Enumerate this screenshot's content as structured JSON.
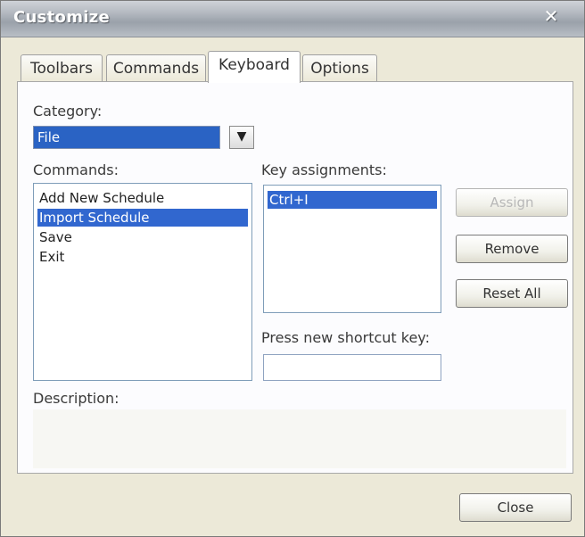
{
  "window": {
    "title": "Customize"
  },
  "tabs": [
    {
      "label": "Toolbars",
      "active": false
    },
    {
      "label": "Commands",
      "active": false
    },
    {
      "label": "Keyboard",
      "active": true
    },
    {
      "label": "Options",
      "active": false
    }
  ],
  "category": {
    "label": "Category:",
    "selected": "File"
  },
  "commands": {
    "label": "Commands:",
    "items": [
      "Add New Schedule",
      "Import Schedule",
      "Save",
      "Exit"
    ],
    "selected_index": 1
  },
  "key_assignments": {
    "label": "Key assignments:",
    "items": [
      "Ctrl+I"
    ],
    "selected_index": 0
  },
  "buttons": {
    "assign": "Assign",
    "remove": "Remove",
    "reset_all": "Reset All",
    "close": "Close"
  },
  "shortcut": {
    "label": "Press new shortcut key:",
    "value": ""
  },
  "description": {
    "label": "Description:"
  },
  "icons": {
    "combo_arrow": "chevron-down-icon",
    "window_close": "close-icon"
  }
}
